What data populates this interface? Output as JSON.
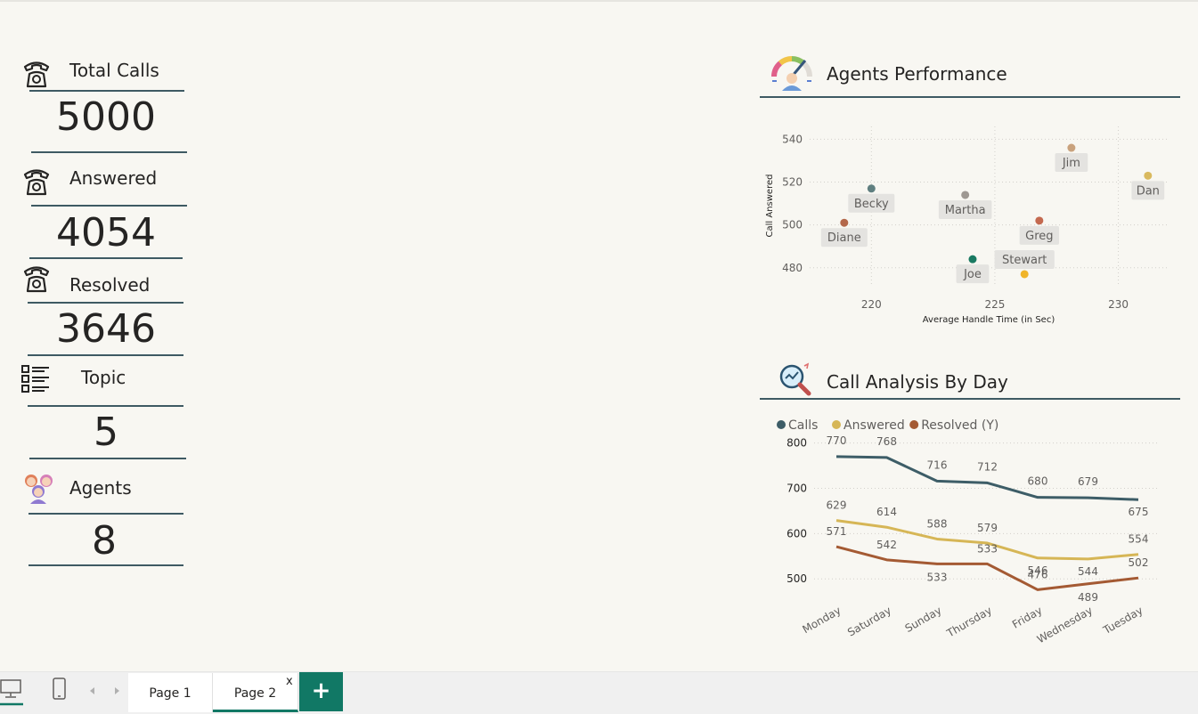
{
  "kpis": [
    {
      "label": "Total Calls",
      "value": "5000",
      "icon": "telephone-icon"
    },
    {
      "label": "Answered",
      "value": "4054",
      "icon": "telephone-icon"
    },
    {
      "label": "Resolved",
      "value": "3646",
      "icon": "telephone-icon"
    },
    {
      "label": "Topic",
      "value": "5",
      "icon": "topic-list-icon"
    },
    {
      "label": "Agents",
      "value": "8",
      "icon": "agents-group-icon"
    }
  ],
  "agents_panel": {
    "title": "Agents Performance",
    "icon": "performance-gauge-icon",
    "chart_data": {
      "type": "scatter",
      "xlabel": "Average Handle Time (in Sec)",
      "ylabel": "Call Answered",
      "xlim": [
        217.5,
        232
      ],
      "ylim": [
        472,
        546
      ],
      "xticks": [
        220,
        225,
        230
      ],
      "yticks": [
        480,
        500,
        520,
        540
      ],
      "grid": true,
      "points": [
        {
          "name": "Jim",
          "x": 228.1,
          "y": 536,
          "color": "#c9a27d"
        },
        {
          "name": "Dan",
          "x": 231.2,
          "y": 523,
          "color": "#d9b95e"
        },
        {
          "name": "Becky",
          "x": 220.0,
          "y": 517,
          "color": "#5f7f80"
        },
        {
          "name": "Martha",
          "x": 223.8,
          "y": 514,
          "color": "#9e9892"
        },
        {
          "name": "Diane",
          "x": 218.9,
          "y": 501,
          "color": "#b3674a"
        },
        {
          "name": "Greg",
          "x": 226.8,
          "y": 502,
          "color": "#c4694f"
        },
        {
          "name": "Joe",
          "x": 224.1,
          "y": 484,
          "color": "#1a7a62"
        },
        {
          "name": "Stewart",
          "x": 226.2,
          "y": 477,
          "color": "#f0b429"
        }
      ]
    }
  },
  "day_panel": {
    "title": "Call Analysis By Day",
    "icon": "magnifier-analysis-icon",
    "chart_data": {
      "type": "line",
      "categories": [
        "Monday",
        "Saturday",
        "Sunday",
        "Thursday",
        "Friday",
        "Wednesday",
        "Tuesday"
      ],
      "ylim": [
        465,
        815
      ],
      "yticks": [
        500,
        600,
        700,
        800
      ],
      "grid": true,
      "legend": "top-left",
      "series": [
        {
          "name": "Calls",
          "color": "#3d5d67",
          "values": [
            770,
            768,
            716,
            712,
            680,
            679,
            675
          ]
        },
        {
          "name": "Answered",
          "color": "#d6b656",
          "values": [
            629,
            614,
            588,
            579,
            546,
            544,
            554
          ]
        },
        {
          "name": "Resolved (Y)",
          "color": "#a45a33",
          "values": [
            571,
            542,
            533,
            533,
            476,
            489,
            502
          ]
        }
      ]
    }
  },
  "tabs": [
    {
      "label": "Page 1",
      "active": false
    },
    {
      "label": "Page 2",
      "active": true
    }
  ],
  "tab_close": "x",
  "add_tab_label": "+",
  "colors": {
    "accent": "#117865",
    "rule": "#3e5a63",
    "background": "#f8f7f2"
  }
}
